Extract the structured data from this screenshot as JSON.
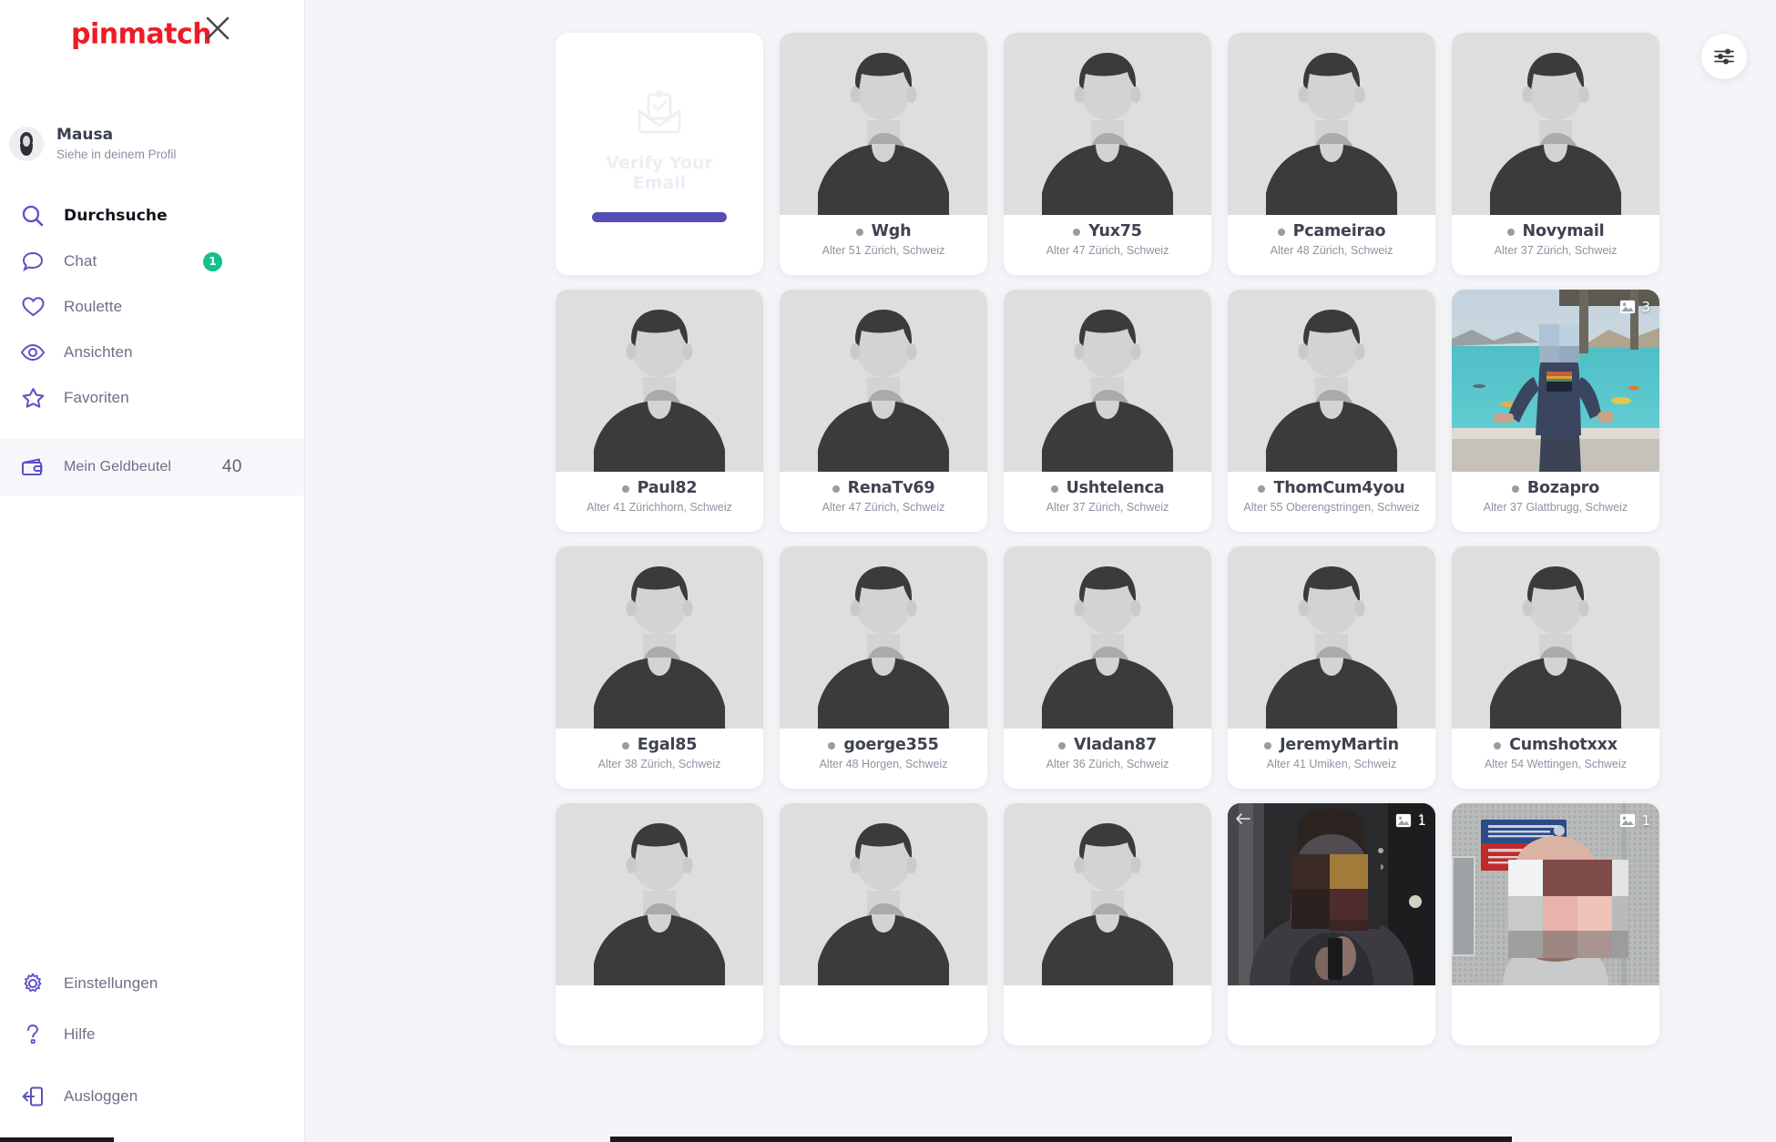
{
  "brand": {
    "logo_text": "pinmatch",
    "logo_color": "#ed1c24"
  },
  "sidebar": {
    "close_icon": "close-icon",
    "profile": {
      "name": "Mausa",
      "subtitle": "Siehe in deinem Profil",
      "avatar_icon": "user-avatar-icon"
    },
    "nav": [
      {
        "label": "Durchsuche",
        "icon": "search-icon",
        "active": true,
        "badge": ""
      },
      {
        "label": "Chat",
        "icon": "chat-bubble-icon",
        "active": false,
        "badge": "1"
      },
      {
        "label": "Roulette",
        "icon": "heart-icon",
        "active": false,
        "badge": ""
      },
      {
        "label": "Ansichten",
        "icon": "eye-icon",
        "active": false,
        "badge": ""
      },
      {
        "label": "Favoriten",
        "icon": "star-icon",
        "active": false,
        "badge": ""
      }
    ],
    "wallet": {
      "label": "Mein Geldbeutel",
      "count": "40",
      "icon": "wallet-icon"
    },
    "bottom": [
      {
        "label": "Einstellungen",
        "icon": "gear-icon"
      },
      {
        "label": "Hilfe",
        "icon": "question-mark-icon"
      },
      {
        "label": "Ausloggen",
        "icon": "logout-icon"
      }
    ]
  },
  "main": {
    "filter_button_icon": "sliders-filter-icon",
    "verify_card": {
      "title": "Verify Your Email",
      "icon": "envelope-check-icon",
      "bar_color": "#554fb5"
    },
    "accent_color": "#554fb5",
    "badge_color": "#12c08c"
  },
  "profiles": [
    {
      "name": "Wgh",
      "info": "Alter 51 Zürich, Schweiz",
      "photo": "placeholder",
      "photo_count": ""
    },
    {
      "name": "Yux75",
      "info": "Alter 47 Zürich, Schweiz",
      "photo": "placeholder",
      "photo_count": ""
    },
    {
      "name": "Pcameirao",
      "info": "Alter 48 Zürich, Schweiz",
      "photo": "placeholder",
      "photo_count": ""
    },
    {
      "name": "Novymail",
      "info": "Alter 37 Zürich, Schweiz",
      "photo": "placeholder",
      "photo_count": ""
    },
    {
      "name": "Paul82",
      "info": "Alter 41 Zürichhorn, Schweiz",
      "photo": "placeholder",
      "photo_count": ""
    },
    {
      "name": "RenaTv69",
      "info": "Alter 47 Zürich, Schweiz",
      "photo": "placeholder",
      "photo_count": ""
    },
    {
      "name": "Ushtelenca",
      "info": "Alter 37 Zürich, Schweiz",
      "photo": "placeholder",
      "photo_count": ""
    },
    {
      "name": "ThomCum4you",
      "info": "Alter 55 Oberengstringen, Schweiz",
      "photo": "placeholder",
      "photo_count": ""
    },
    {
      "name": "Bozapro",
      "info": "Alter 37 Glattbrugg, Schweiz",
      "photo": "beach-photo",
      "photo_count": "3"
    },
    {
      "name": "Egal85",
      "info": "Alter 38 Zürich, Schweiz",
      "photo": "placeholder",
      "photo_count": ""
    },
    {
      "name": "goerge355",
      "info": "Alter 48 Horgen, Schweiz",
      "photo": "placeholder",
      "photo_count": ""
    },
    {
      "name": "Vladan87",
      "info": "Alter 36 Zürich, Schweiz",
      "photo": "placeholder",
      "photo_count": ""
    },
    {
      "name": "JeremyMartin",
      "info": "Alter 41 Umiken, Schweiz",
      "photo": "placeholder",
      "photo_count": ""
    },
    {
      "name": "Cumshotxxx",
      "info": "Alter 54 Wettingen, Schweiz",
      "photo": "placeholder",
      "photo_count": ""
    },
    {
      "name": "",
      "info": "",
      "photo": "placeholder",
      "photo_count": ""
    },
    {
      "name": "",
      "info": "",
      "photo": "placeholder",
      "photo_count": ""
    },
    {
      "name": "",
      "info": "",
      "photo": "placeholder",
      "photo_count": ""
    },
    {
      "name": "",
      "info": "",
      "photo": "corridor-photo",
      "photo_count": "1"
    },
    {
      "name": "",
      "info": "",
      "photo": "elevator-photo",
      "photo_count": "1"
    }
  ]
}
